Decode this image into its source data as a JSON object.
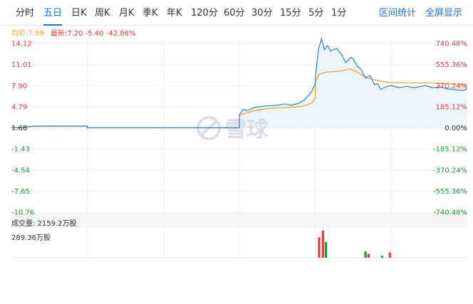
{
  "tabs": {
    "items": [
      "分时",
      "五日",
      "日K",
      "周K",
      "月K",
      "季K",
      "年K",
      "120分",
      "60分",
      "30分",
      "15分",
      "5分",
      "1分"
    ],
    "active": "五日",
    "right_items": [
      "区间统计",
      "全屏显示"
    ]
  },
  "legend": {
    "avg": "均价:7.99",
    "latest_label": "最新:",
    "latest_value": "7.20",
    "change": "-5.40",
    "change_pct": "-42.86%"
  },
  "watermark": "雪球",
  "volume_label": "成交量: 2159.2万股",
  "volume_max_label": "289.36万股",
  "colors": {
    "accent": "#1d6fd6",
    "price_line": "#2e86c1",
    "avg_line": "#f59f2b",
    "up": "#e23b3b",
    "down": "#1c9a3a",
    "neutral": "#333333"
  },
  "chart_data": {
    "type": "line",
    "left_ticks": [
      "14.12",
      "11.01",
      "7.90",
      "4.79",
      "1.68",
      "-1.43",
      "-4.54",
      "-7.65",
      "-10.76"
    ],
    "right_ticks": [
      "740.48%",
      "555.36%",
      "370.24%",
      "185.12%",
      "0.00%",
      "-185.12%",
      "-370.24%",
      "-555.36%",
      "-740.48%"
    ],
    "ylim": [
      -10.76,
      14.12
    ],
    "days": 5,
    "series": [
      {
        "values": [
          [
            0.0,
            1.68
          ],
          [
            0.12,
            1.68
          ],
          [
            0.3,
            1.95
          ],
          [
            0.6,
            1.95
          ],
          [
            1.0,
            1.95
          ],
          [
            1.0,
            1.68
          ],
          [
            1.5,
            1.68
          ],
          [
            2.0,
            1.68
          ],
          [
            2.0,
            1.68
          ],
          [
            2.4,
            1.68
          ],
          [
            3.0,
            1.68
          ],
          [
            3.0,
            3.6
          ],
          [
            3.05,
            4.4
          ],
          [
            3.1,
            4.2
          ],
          [
            3.2,
            4.7
          ],
          [
            3.35,
            4.9
          ],
          [
            3.5,
            5.0
          ],
          [
            3.6,
            5.2
          ],
          [
            3.68,
            5.0
          ],
          [
            3.78,
            5.3
          ],
          [
            3.86,
            5.8
          ],
          [
            3.95,
            7.0
          ],
          [
            4.0,
            8.2
          ],
          [
            4.0,
            9.0
          ],
          [
            4.04,
            13.2
          ],
          [
            4.08,
            14.8
          ],
          [
            4.12,
            13.2
          ],
          [
            4.16,
            13.8
          ],
          [
            4.2,
            13.0
          ],
          [
            4.28,
            13.4
          ],
          [
            4.35,
            12.4
          ],
          [
            4.4,
            11.3
          ],
          [
            4.47,
            12.1
          ],
          [
            4.5,
            11.8
          ],
          [
            4.55,
            10.8
          ],
          [
            4.6,
            10.3
          ],
          [
            4.66,
            9.0
          ],
          [
            4.72,
            9.4
          ],
          [
            4.78,
            8.0
          ],
          [
            4.82,
            8.2
          ],
          [
            4.86,
            7.3
          ],
          [
            4.92,
            7.7
          ],
          [
            5.0,
            7.9
          ],
          [
            5.1,
            7.6
          ],
          [
            5.2,
            7.8
          ],
          [
            5.3,
            7.6
          ],
          [
            5.45,
            7.9
          ],
          [
            5.55,
            7.6
          ],
          [
            5.65,
            7.7
          ],
          [
            5.75,
            7.4
          ],
          [
            5.85,
            7.3
          ],
          [
            5.95,
            7.2
          ],
          [
            6.0,
            7.45
          ]
        ]
      },
      {
        "values": [
          [
            0.0,
            1.68
          ],
          [
            0.12,
            1.75
          ],
          [
            0.3,
            1.9
          ],
          [
            1.0,
            1.9
          ],
          [
            1.0,
            1.68
          ],
          [
            2.0,
            1.68
          ],
          [
            3.0,
            1.68
          ],
          [
            3.0,
            3.5
          ],
          [
            3.1,
            3.9
          ],
          [
            3.2,
            4.2
          ],
          [
            3.35,
            4.5
          ],
          [
            3.5,
            4.6
          ],
          [
            3.7,
            4.7
          ],
          [
            3.85,
            4.9
          ],
          [
            3.95,
            5.3
          ],
          [
            4.0,
            6.0
          ],
          [
            4.0,
            8.5
          ],
          [
            4.05,
            9.6
          ],
          [
            4.15,
            9.9
          ],
          [
            4.3,
            10.0
          ],
          [
            4.4,
            10.2
          ],
          [
            4.45,
            10.4
          ],
          [
            4.55,
            9.9
          ],
          [
            4.62,
            9.4
          ],
          [
            4.7,
            9.0
          ],
          [
            4.8,
            8.7
          ],
          [
            4.9,
            8.45
          ],
          [
            5.0,
            8.35
          ],
          [
            5.2,
            8.3
          ],
          [
            5.45,
            8.3
          ],
          [
            5.7,
            8.25
          ],
          [
            5.85,
            8.1
          ],
          [
            6.0,
            7.99
          ]
        ]
      }
    ],
    "volume": [
      {
        "x": 4.05,
        "v": 0.72,
        "dir": "up"
      },
      {
        "x": 4.1,
        "v": 0.95,
        "dir": "up"
      },
      {
        "x": 4.14,
        "v": 0.55,
        "dir": "down"
      },
      {
        "x": 4.66,
        "v": 0.22,
        "dir": "down"
      },
      {
        "x": 4.7,
        "v": 0.14,
        "dir": "up"
      },
      {
        "x": 4.88,
        "v": 0.07,
        "dir": "down"
      },
      {
        "x": 4.98,
        "v": 0.19,
        "dir": "up"
      }
    ],
    "grid": true
  }
}
